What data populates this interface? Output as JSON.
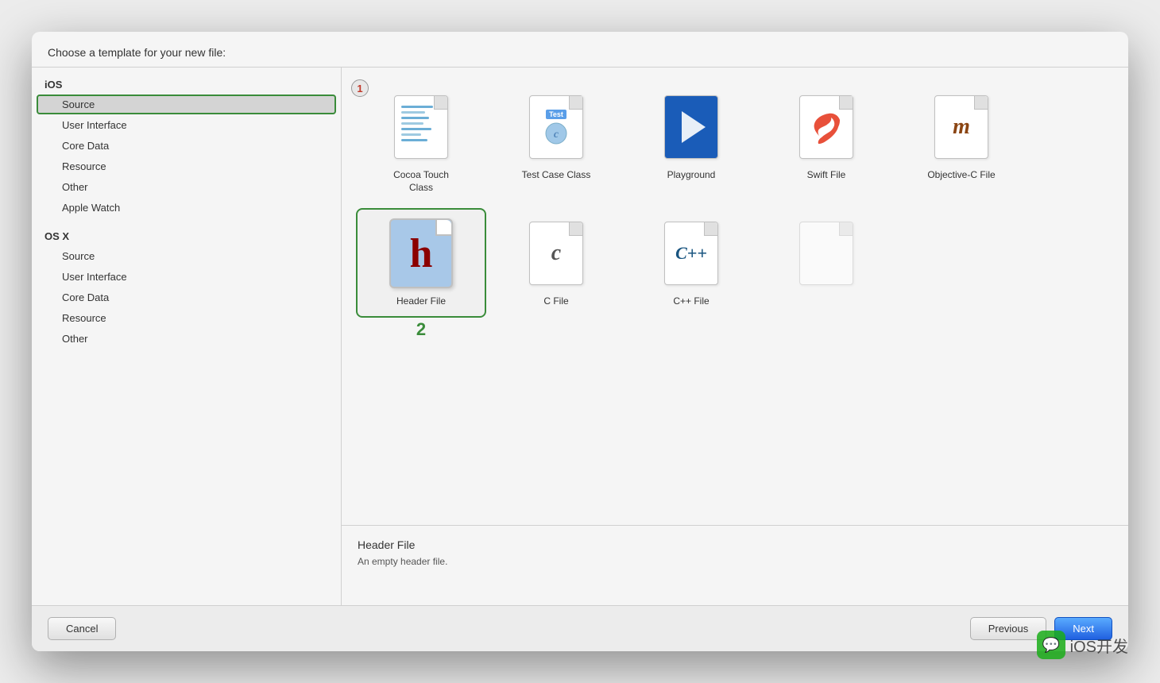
{
  "dialog": {
    "header": "Choose a template for your new file:",
    "sidebar": {
      "groups": [
        {
          "label": "iOS",
          "items": [
            {
              "id": "ios-source",
              "label": "Source",
              "selected": true
            },
            {
              "id": "ios-user-interface",
              "label": "User Interface",
              "selected": false
            },
            {
              "id": "ios-core-data",
              "label": "Core Data",
              "selected": false
            },
            {
              "id": "ios-resource",
              "label": "Resource",
              "selected": false
            },
            {
              "id": "ios-other",
              "label": "Other",
              "selected": false
            },
            {
              "id": "ios-apple-watch",
              "label": "Apple Watch",
              "selected": false
            }
          ]
        },
        {
          "label": "OS X",
          "items": [
            {
              "id": "osx-source",
              "label": "Source",
              "selected": false
            },
            {
              "id": "osx-user-interface",
              "label": "User Interface",
              "selected": false
            },
            {
              "id": "osx-core-data",
              "label": "Core Data",
              "selected": false
            },
            {
              "id": "osx-resource",
              "label": "Resource",
              "selected": false
            },
            {
              "id": "osx-other",
              "label": "Other",
              "selected": false
            }
          ]
        }
      ]
    },
    "templates": [
      {
        "id": "cocoa-touch",
        "label": "Cocoa Touch\nClass",
        "type": "cocoa",
        "badge": "1"
      },
      {
        "id": "test-case",
        "label": "Test Case Class",
        "type": "test"
      },
      {
        "id": "playground",
        "label": "Playground",
        "type": "playground"
      },
      {
        "id": "swift-file",
        "label": "Swift File",
        "type": "swift"
      },
      {
        "id": "objc-file",
        "label": "Objective-C File",
        "type": "objc"
      },
      {
        "id": "header-file",
        "label": "Header File",
        "type": "header",
        "selected": true,
        "badge": "2"
      },
      {
        "id": "c-file",
        "label": "C File",
        "type": "c"
      },
      {
        "id": "cpp-file",
        "label": "C++ File",
        "type": "cpp"
      },
      {
        "id": "partial",
        "label": "",
        "type": "partial"
      }
    ],
    "description": {
      "title": "Header File",
      "text": "An empty header file."
    },
    "footer": {
      "cancel": "Cancel",
      "previous": "Previous",
      "next": "Next"
    }
  }
}
